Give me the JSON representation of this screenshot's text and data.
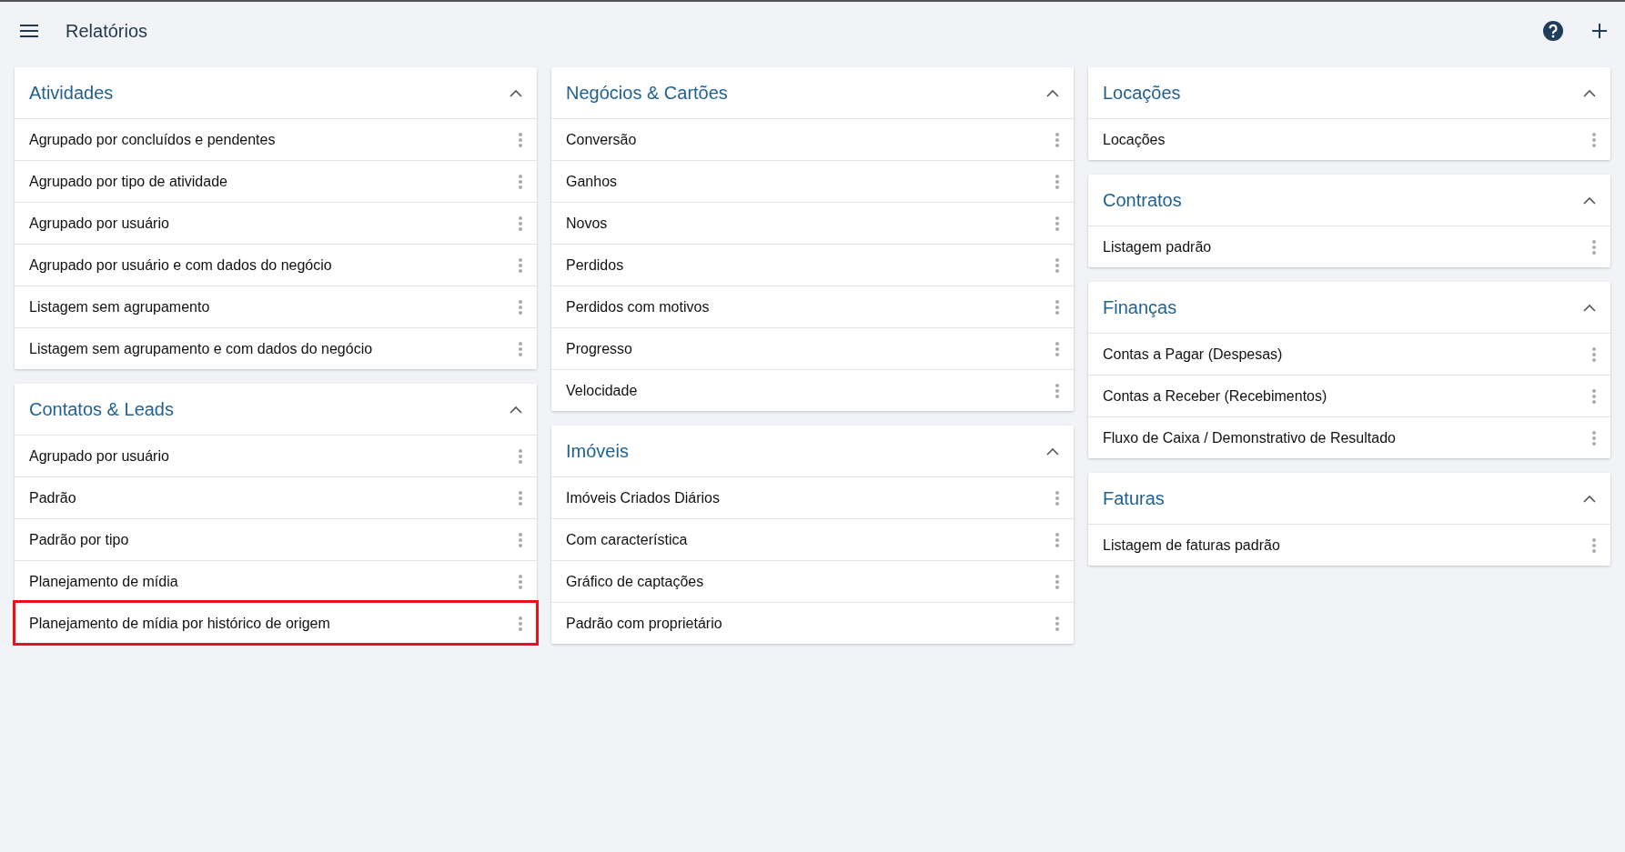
{
  "header": {
    "title": "Relatórios"
  },
  "columns": [
    {
      "cards": [
        {
          "title": "Atividades",
          "expanded": true,
          "items": [
            {
              "label": "Agrupado por concluídos e pendentes",
              "highlighted": false
            },
            {
              "label": "Agrupado por tipo de atividade",
              "highlighted": false
            },
            {
              "label": "Agrupado por usuário",
              "highlighted": false
            },
            {
              "label": "Agrupado por usuário e com dados do negócio",
              "highlighted": false
            },
            {
              "label": "Listagem sem agrupamento",
              "highlighted": false
            },
            {
              "label": "Listagem sem agrupamento e com dados do negócio",
              "highlighted": false
            }
          ]
        },
        {
          "title": "Contatos & Leads",
          "expanded": true,
          "items": [
            {
              "label": "Agrupado por usuário",
              "highlighted": false
            },
            {
              "label": "Padrão",
              "highlighted": false
            },
            {
              "label": "Padrão por tipo",
              "highlighted": false
            },
            {
              "label": "Planejamento de mídia",
              "highlighted": false
            },
            {
              "label": "Planejamento de mídia por histórico de origem",
              "highlighted": true
            }
          ]
        }
      ]
    },
    {
      "cards": [
        {
          "title": "Negócios & Cartões",
          "expanded": true,
          "items": [
            {
              "label": "Conversão",
              "highlighted": false
            },
            {
              "label": "Ganhos",
              "highlighted": false
            },
            {
              "label": "Novos",
              "highlighted": false
            },
            {
              "label": "Perdidos",
              "highlighted": false
            },
            {
              "label": "Perdidos com motivos",
              "highlighted": false
            },
            {
              "label": "Progresso",
              "highlighted": false
            },
            {
              "label": "Velocidade",
              "highlighted": false
            }
          ]
        },
        {
          "title": "Imóveis",
          "expanded": true,
          "items": [
            {
              "label": "Imóveis Criados Diários",
              "highlighted": false
            },
            {
              "label": "Com característica",
              "highlighted": false
            },
            {
              "label": "Gráfico de captações",
              "highlighted": false
            },
            {
              "label": "Padrão com proprietário",
              "highlighted": false
            }
          ]
        }
      ]
    },
    {
      "cards": [
        {
          "title": "Locações",
          "expanded": true,
          "items": [
            {
              "label": "Locações",
              "highlighted": false
            }
          ]
        },
        {
          "title": "Contratos",
          "expanded": true,
          "items": [
            {
              "label": "Listagem padrão",
              "highlighted": false
            }
          ]
        },
        {
          "title": "Finanças",
          "expanded": true,
          "items": [
            {
              "label": "Contas a Pagar (Despesas)",
              "highlighted": false
            },
            {
              "label": "Contas a Receber (Recebimentos)",
              "highlighted": false
            },
            {
              "label": "Fluxo de Caixa / Demonstrativo de Resultado",
              "highlighted": false
            }
          ]
        },
        {
          "title": "Faturas",
          "expanded": true,
          "items": [
            {
              "label": "Listagem de faturas padrão",
              "highlighted": false
            }
          ]
        }
      ]
    }
  ]
}
